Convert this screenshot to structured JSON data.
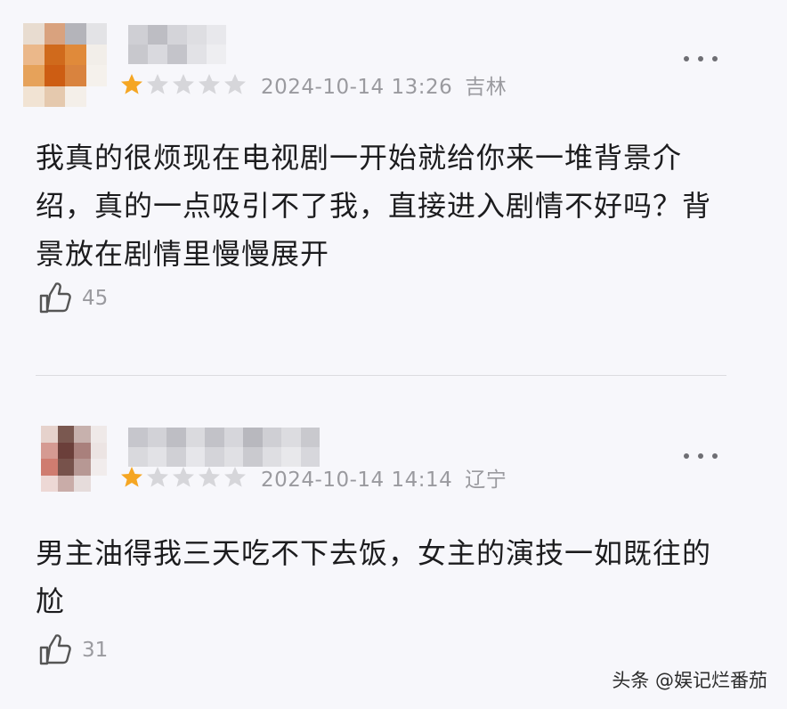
{
  "comments": [
    {
      "rating": 1,
      "max_rating": 5,
      "date": "2024-10-14 13:26",
      "location": "吉林",
      "text": "我真的很烦现在电视剧一开始就给你来一堆背景介绍，真的一点吸引不了我，直接进入剧情不好吗？背景放在剧情里慢慢展开",
      "likes": "45"
    },
    {
      "rating": 1,
      "max_rating": 5,
      "date": "2024-10-14 14:14",
      "location": "辽宁",
      "text": "男主油得我三天吃不下去饭，女主的演技一如既往的尬",
      "likes": "31"
    }
  ],
  "colors": {
    "star_filled": "#f5a623",
    "star_empty": "#d6d6da",
    "meta_text": "#9a9a9f",
    "background": "#f7f7fb"
  },
  "icons": {
    "like": "thumbs-up-icon",
    "more": "more-dots-icon",
    "star": "star-icon"
  },
  "watermark": "头条 @娱记烂番茄"
}
